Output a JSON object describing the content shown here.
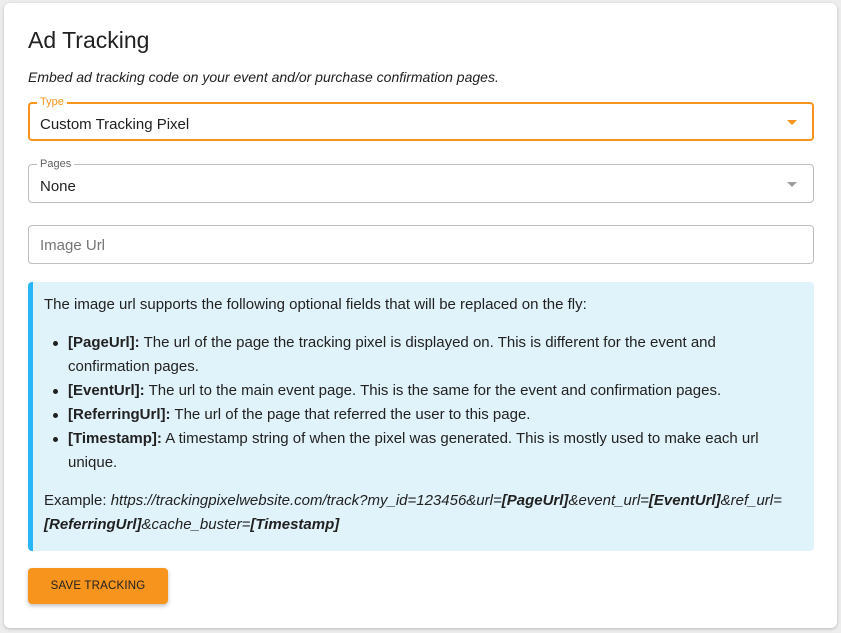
{
  "header": {
    "title": "Ad Tracking",
    "subtitle": "Embed ad tracking code on your event and/or purchase confirmation pages."
  },
  "type_field": {
    "label": "Type",
    "value": "Custom Tracking Pixel",
    "icon": "chevron-down-icon",
    "accent_color": "#f7941d"
  },
  "pages_field": {
    "label": "Pages",
    "value": "None",
    "icon": "chevron-down-icon"
  },
  "image_url_field": {
    "placeholder": "Image Url",
    "value": ""
  },
  "info_box": {
    "intro": "The image url supports the following optional fields that will be replaced on the fly:",
    "items": [
      {
        "key": "[PageUrl]:",
        "text": " The url of the page the tracking pixel is displayed on. This is different for the event and confirmation pages."
      },
      {
        "key": "[EventUrl]:",
        "text": " The url to the main event page. This is the same for the event and confirmation pages."
      },
      {
        "key": "[ReferringUrl]:",
        "text": " The url of the page that referred the user to this page."
      },
      {
        "key": "[Timestamp]:",
        "text": " A timestamp string of when the pixel was generated. This is mostly used to make each url unique."
      }
    ],
    "example_label": "Example: ",
    "example_parts": {
      "p1": "https://trackingpixelwebsite.com/track?my_id=123456&url=",
      "b1": "[PageUrl]",
      "p2": "&event_url=",
      "b2": "[EventUrl]",
      "p3": "&ref_url=",
      "b3": "[ReferringUrl]",
      "p4": "&cache_buster=",
      "b4": "[Timestamp]"
    },
    "accent_color": "#29b6f6",
    "background_color": "#e1f3fa"
  },
  "save_button": {
    "label": "SAVE TRACKING",
    "color": "#f7941d"
  }
}
